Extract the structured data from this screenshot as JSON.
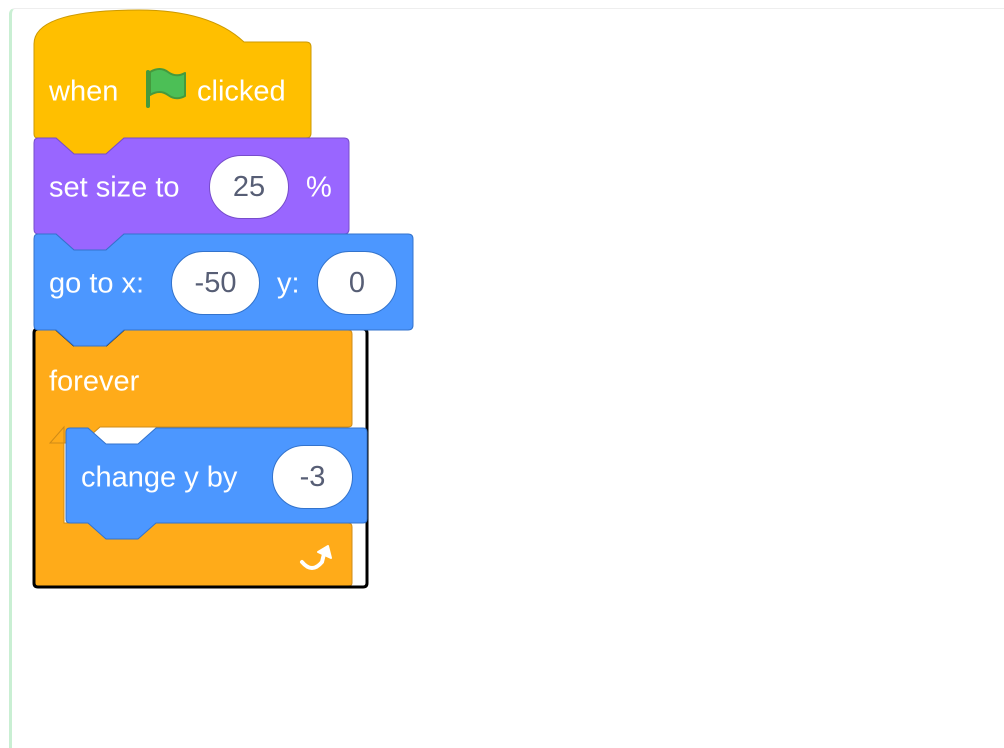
{
  "script": {
    "hat_block": {
      "label_when": "when",
      "label_clicked": "clicked",
      "icon": "green-flag-icon",
      "color": "#ffbf00"
    },
    "set_size_block": {
      "label": "set size to",
      "value": "25",
      "suffix": "%",
      "color": "#9966ff"
    },
    "go_to_block": {
      "label_x": "go to x:",
      "x_value": "-50",
      "label_y": "y:",
      "y_value": "0",
      "color": "#4c97ff"
    },
    "forever_block": {
      "label": "forever",
      "icon": "repeat-arrow-icon",
      "color": "#ffab19",
      "highlighted": true
    },
    "change_y_block": {
      "label": "change y by",
      "value": "-3",
      "color": "#4c97ff"
    }
  }
}
